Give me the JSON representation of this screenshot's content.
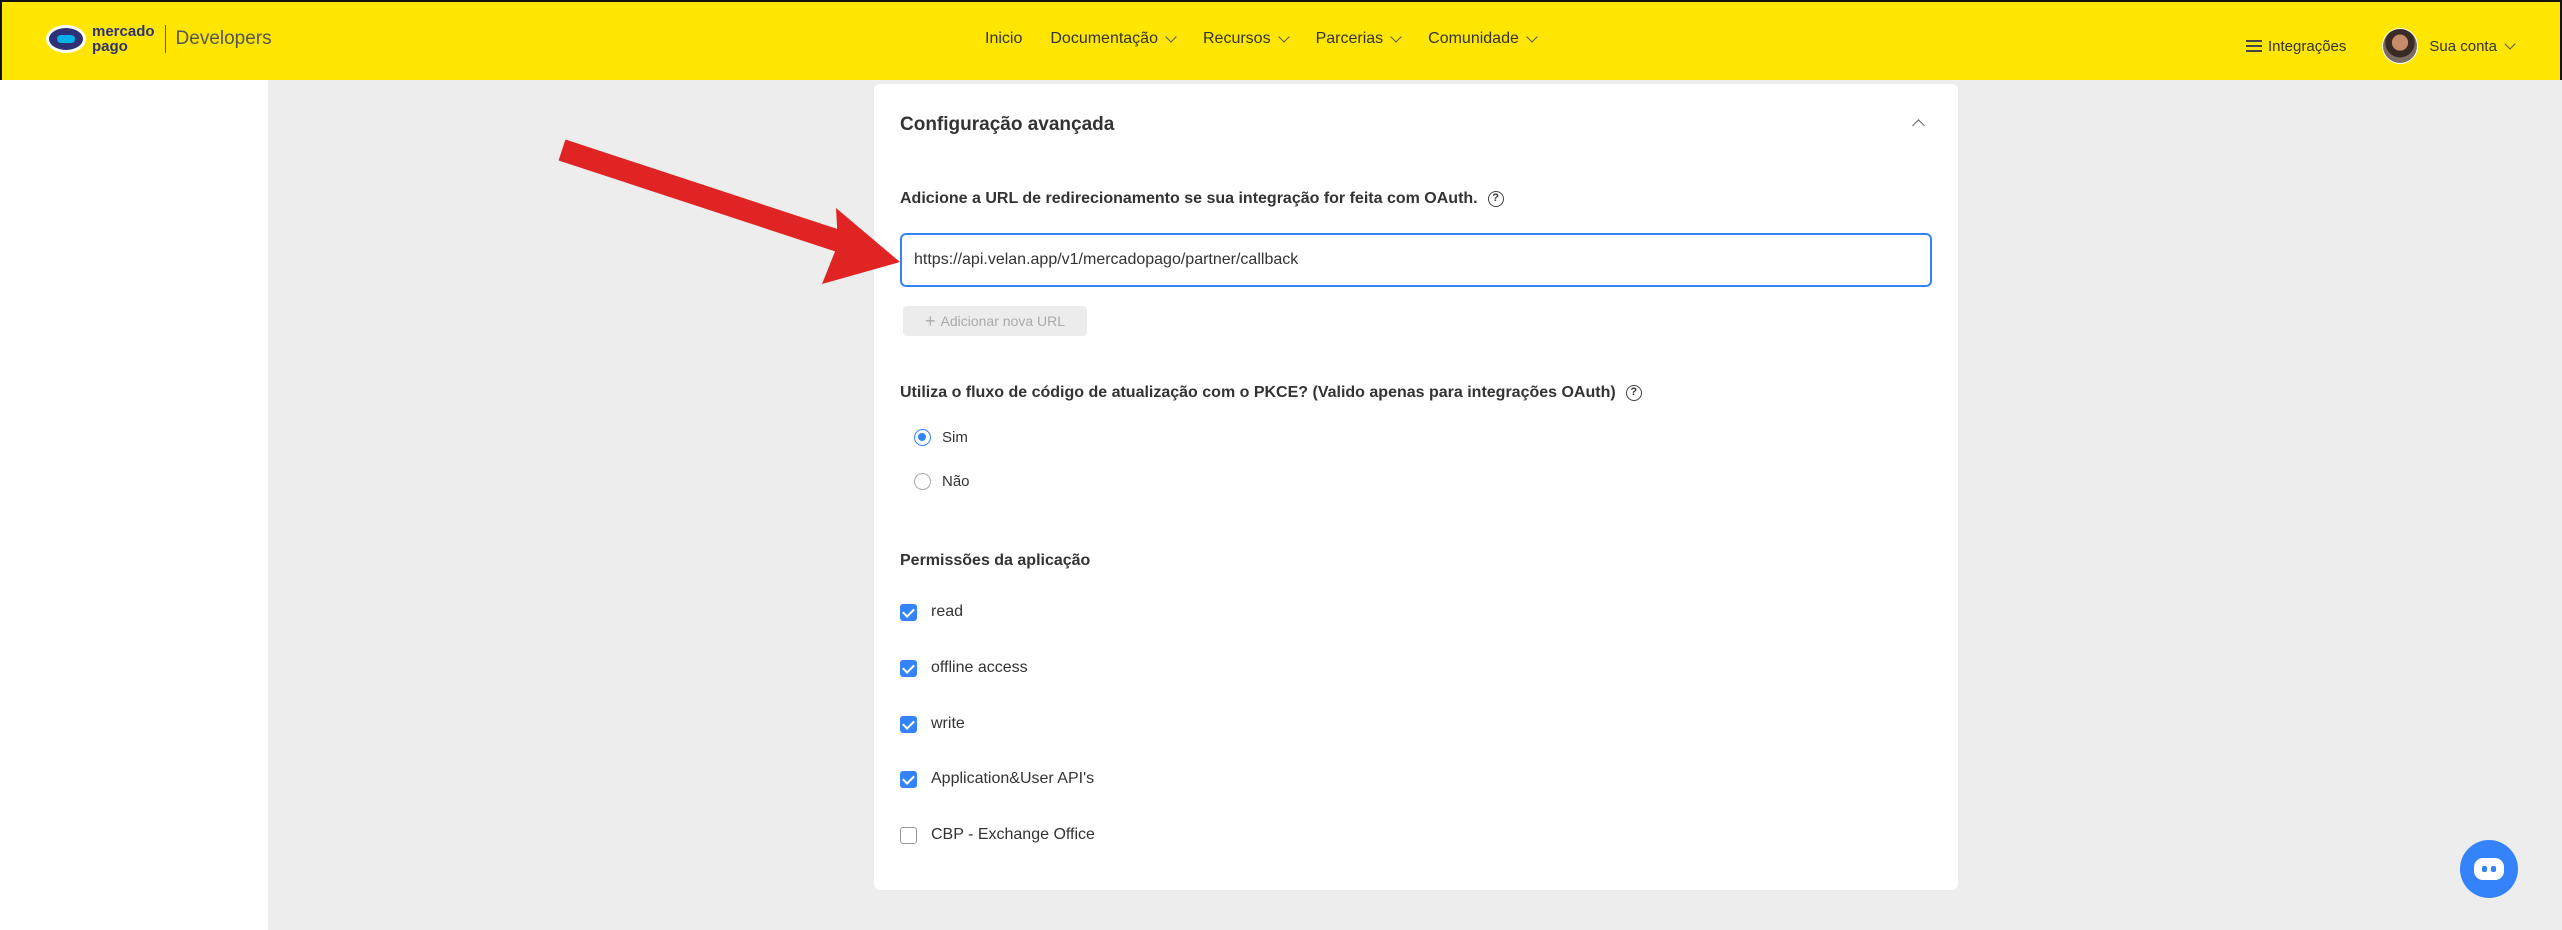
{
  "header": {
    "logo_text_line1": "mercado",
    "logo_text_line2": "pago",
    "logo_suffix": "Developers",
    "nav": [
      {
        "label": "Inicio",
        "dropdown": false
      },
      {
        "label": "Documentação",
        "dropdown": true
      },
      {
        "label": "Recursos",
        "dropdown": true
      },
      {
        "label": "Parcerias",
        "dropdown": true
      },
      {
        "label": "Comunidade",
        "dropdown": true
      }
    ],
    "integrations_label": "Integrações",
    "account_label": "Sua conta"
  },
  "card": {
    "title": "Configuração avançada",
    "redirect_label": "Adicione a URL de redirecionamento se sua integração for feita com OAuth.",
    "redirect_url_value": "https://api.velan.app/v1/mercadopago/partner/callback",
    "add_url_label": "Adicionar nova URL",
    "pkce_label": "Utiliza o fluxo de código de atualização com o PKCE? (Valido apenas para integrações OAuth)",
    "pkce_options": [
      {
        "label": "Sim",
        "selected": true
      },
      {
        "label": "Não",
        "selected": false
      }
    ],
    "permissions_label": "Permissões da aplicação",
    "permissions": [
      {
        "label": "read",
        "checked": true
      },
      {
        "label": "offline access",
        "checked": true
      },
      {
        "label": "write",
        "checked": true
      },
      {
        "label": "Application&User API's",
        "checked": true
      },
      {
        "label": "CBP - Exchange Office",
        "checked": false
      }
    ]
  },
  "colors": {
    "header_bg": "#ffe600",
    "accent": "#3483fa",
    "annotation_arrow": "#e02424"
  }
}
